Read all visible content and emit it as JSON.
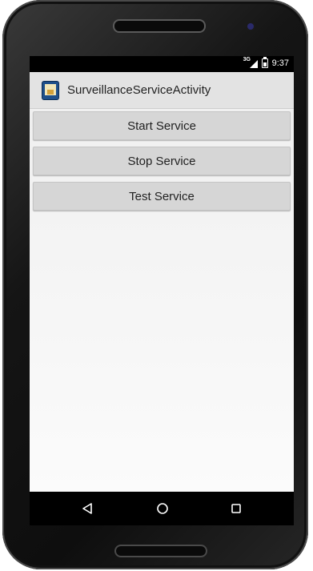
{
  "status_bar": {
    "network": "3G",
    "time": "9:37"
  },
  "action_bar": {
    "app_icon": "app-launcher-icon",
    "title": "SurveillanceServiceActivity"
  },
  "buttons": [
    {
      "label": "Start Service"
    },
    {
      "label": "Stop Service"
    },
    {
      "label": "Test Service"
    }
  ],
  "nav_bar": {
    "back_icon": "back-triangle-icon",
    "home_icon": "home-circle-icon",
    "recents_icon": "recents-square-icon"
  },
  "colors": {
    "action_bar_bg": "#e3e3e3",
    "button_bg": "#d6d6d6",
    "status_bar_bg": "#000000",
    "screen_bg": "#f2f2f2"
  }
}
